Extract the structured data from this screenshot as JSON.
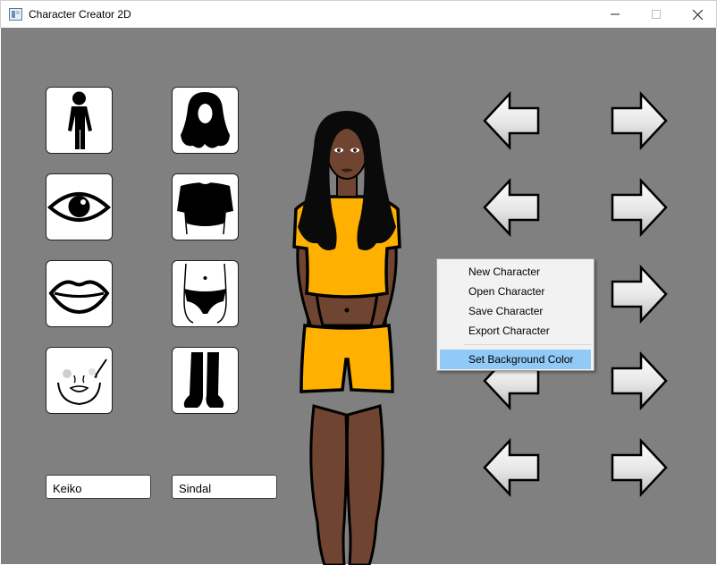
{
  "window": {
    "title": "Character Creator 2D",
    "controls": {
      "minimize": "—",
      "maximize": "☐",
      "close": "✕"
    }
  },
  "canvas": {
    "background_color": "#808080"
  },
  "category_tiles": [
    {
      "name": "body-type",
      "icon": "body-silhouette-icon"
    },
    {
      "name": "hairstyle",
      "icon": "long-hair-icon"
    },
    {
      "name": "eyes",
      "icon": "eye-icon"
    },
    {
      "name": "top",
      "icon": "shirt-icon"
    },
    {
      "name": "lips",
      "icon": "lips-icon"
    },
    {
      "name": "bottom",
      "icon": "underwear-icon"
    },
    {
      "name": "makeup",
      "icon": "makeup-brush-icon"
    },
    {
      "name": "footwear",
      "icon": "boots-icon"
    }
  ],
  "name_fields": {
    "first_name": "Keiko",
    "last_name": "Sindal"
  },
  "arrow_rows": 5,
  "character": {
    "skin_color": "#6f4532",
    "hair_color": "#0a0a0a",
    "outfit_color": "#ffb000"
  },
  "context_menu": {
    "items": [
      {
        "label": "New Character"
      },
      {
        "label": "Open Character"
      },
      {
        "label": "Save Character"
      },
      {
        "label": "Export Character"
      }
    ],
    "selected_item": {
      "label": "Set Background Color"
    }
  }
}
